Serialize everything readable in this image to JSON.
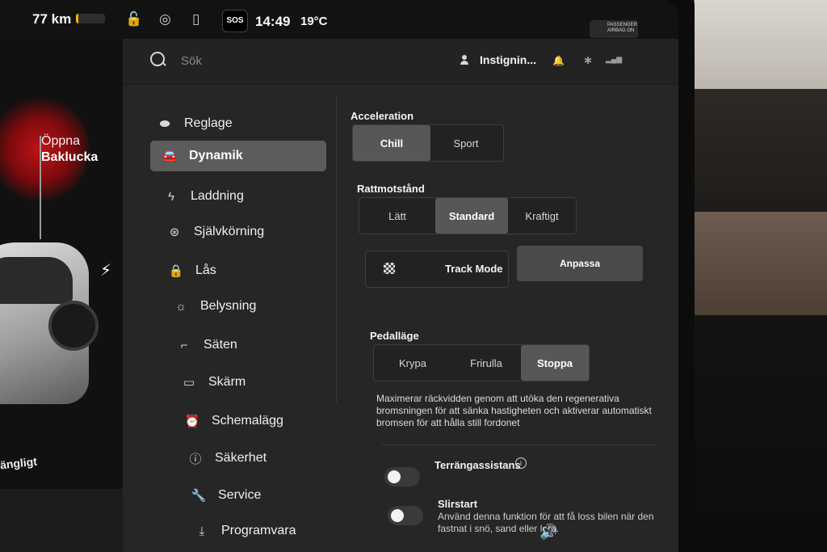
{
  "status": {
    "range": "77 km",
    "battery_level_percent": 8,
    "time": "14:49",
    "temperature": "19°C",
    "sos": "SOS",
    "passenger_airbag": "PASSENGER AIRBAG ON",
    "icons": [
      "lock-open-icon",
      "sentry-icon",
      "phone-key-icon"
    ]
  },
  "car": {
    "open_label": "Öppna",
    "trunk_label": "Baklucka",
    "bottom_label": "ängligt",
    "charge_icon": "bolt-icon"
  },
  "topbar": {
    "search_placeholder": "Sök",
    "user_name": "Instignin...",
    "icons": [
      "bell-icon",
      "bluetooth-icon",
      "lte-signal-icon"
    ]
  },
  "nav": {
    "items": [
      {
        "label": "Reglage",
        "icon": "toggle-icon"
      },
      {
        "label": "Dynamik",
        "icon": "car-icon"
      },
      {
        "label": "Laddning",
        "icon": "bolt-icon"
      },
      {
        "label": "Självkörning",
        "icon": "steering-wheel-icon"
      },
      {
        "label": "Lås",
        "icon": "lock-icon"
      },
      {
        "label": "Belysning",
        "icon": "light-icon"
      },
      {
        "label": "Säten",
        "icon": "seat-icon"
      },
      {
        "label": "Skärm",
        "icon": "display-icon"
      },
      {
        "label": "Schemalägg",
        "icon": "alarm-clock-icon"
      },
      {
        "label": "Säkerhet",
        "icon": "alert-circle-icon"
      },
      {
        "label": "Service",
        "icon": "wrench-icon"
      },
      {
        "label": "Programvara",
        "icon": "download-icon"
      }
    ],
    "active": "Dynamik"
  },
  "settings": {
    "acceleration": {
      "title": "Acceleration",
      "options": [
        "Chill",
        "Sport"
      ],
      "selected": "Chill"
    },
    "steering": {
      "title": "Rattmotstånd",
      "options": [
        "Lätt",
        "Standard",
        "Kraftigt"
      ],
      "selected": "Standard"
    },
    "track_mode": {
      "label": "Track Mode",
      "custom_label": "Anpassa"
    },
    "pedal": {
      "title": "Pedalläge",
      "options": [
        "Krypa",
        "Frirulla",
        "Stoppa"
      ],
      "selected": "Stoppa",
      "description": "Maximerar räckvidden genom att utöka den regenerativa bromsningen för att sänka hastigheten och aktiverar automatiskt bromsen för att hålla still fordonet"
    },
    "terrain_assist": {
      "label": "Terrängassistans",
      "enabled": false
    },
    "slip_start": {
      "label": "Slirstart",
      "enabled": false,
      "description": "Använd denna funktion för att få loss bilen när den fastnat i snö, sand eller lera."
    }
  }
}
